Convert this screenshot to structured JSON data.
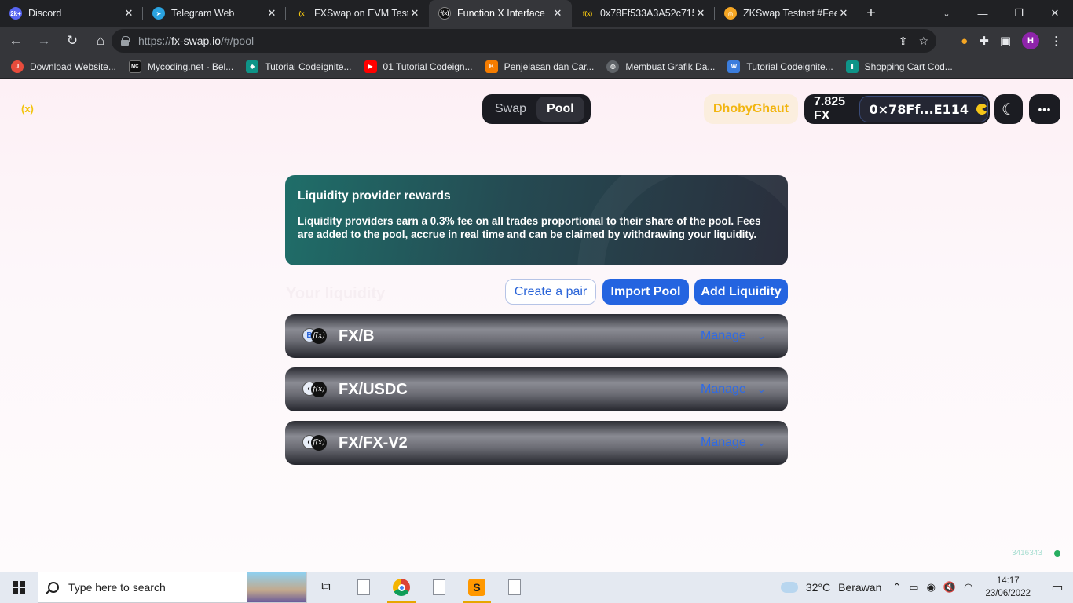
{
  "browser": {
    "tabs": [
      {
        "title": "Discord",
        "fav_color": "#5865f2",
        "fav_text": "2k+",
        "active": false
      },
      {
        "title": "Telegram Web",
        "fav_color": "#2aa3e0",
        "fav_text": "➤",
        "active": false
      },
      {
        "title": "FXSwap on EVM Testn",
        "fav_color": "#202124",
        "fav_text": "(x",
        "active": false
      },
      {
        "title": "Function X Interface",
        "fav_color": "#111111",
        "fav_text": "f(x)",
        "active": true
      },
      {
        "title": "0x78Ff533A3A52c715‹",
        "fav_color": "#202124",
        "fav_text": "f(x)",
        "active": false
      },
      {
        "title": "ZKSwap Testnet #Feed",
        "fav_color": "#f5a623",
        "fav_text": "◎",
        "active": false
      }
    ],
    "new_tab": "+",
    "window_controls": {
      "minimize": "—",
      "restore": "❐",
      "close": "✕"
    },
    "tab_search": "⌄",
    "url": {
      "scheme": "https://",
      "host": "fx-swap.io",
      "path": "/#/pool"
    },
    "bookmarks": [
      {
        "label": "Download Website...",
        "color": "#e74c3c",
        "icon": "J"
      },
      {
        "label": "Mycoding.net - Bel...",
        "color": "#111111",
        "icon": "MC"
      },
      {
        "label": "Tutorial Codeignite...",
        "color": "#0e9488",
        "icon": "◆"
      },
      {
        "label": "01 Tutorial Codeign...",
        "color": "#ff0000",
        "icon": "▶"
      },
      {
        "label": "Penjelasan dan Car...",
        "color": "#f57c00",
        "icon": "B"
      },
      {
        "label": "Membuat Grafik Da...",
        "color": "#5f6368",
        "icon": "◍"
      },
      {
        "label": "Tutorial Codeignite...",
        "color": "#3b7ddd",
        "icon": "W"
      },
      {
        "label": "Shopping Cart Cod...",
        "color": "#0e9488",
        "icon": "▮"
      }
    ],
    "profile_initial": "H"
  },
  "app": {
    "logo_text": "(x)",
    "nav": {
      "swap": "Swap",
      "pool": "Pool"
    },
    "network": "DhobyGhaut",
    "balance": "7.825 FX",
    "address": "0×78Ff...E114",
    "theme_icon": "☾",
    "more_icon": "•••"
  },
  "banner": {
    "title": "Liquidity provider rewards",
    "body": "Liquidity providers earn a 0.3% fee on all trades proportional to their share of the pool. Fees are added to the pool, accrue in real time and can be claimed by withdrawing your liquidity."
  },
  "liquidity": {
    "heading": "Your liquidity",
    "create_pair": "Create a pair",
    "import_pool": "Import Pool",
    "add_liquidity": "Add Liquidity",
    "pairs": [
      {
        "name": "FX/B",
        "token_a": "B",
        "manage": "Manage"
      },
      {
        "name": "FX/USDC",
        "token_a": "◐",
        "manage": "Manage"
      },
      {
        "name": "FX/FX-V2",
        "token_a": "◐",
        "manage": "Manage"
      }
    ]
  },
  "footer": {
    "block_number": "3416343"
  },
  "taskbar": {
    "search_placeholder": "Type here to search",
    "weather_temp": "32°C",
    "weather_desc": "Berawan",
    "time": "14:17",
    "date": "23/06/2022"
  }
}
